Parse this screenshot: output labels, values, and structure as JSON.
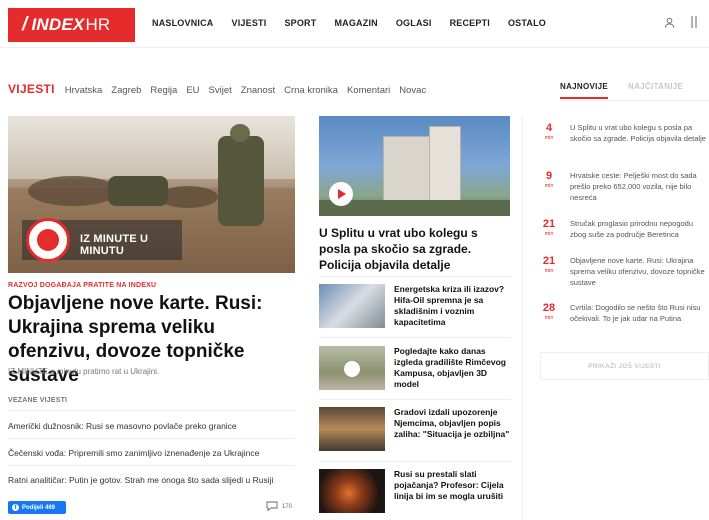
{
  "header": {
    "logo_text": "INDEX",
    "logo_suffix": "HR",
    "nav": [
      "NASLOVNICA",
      "VIJESTI",
      "SPORT",
      "MAGAZIN",
      "OGLASI",
      "RECEPTI",
      "OSTALO"
    ],
    "icons": [
      "user-icon",
      "menu-icon"
    ]
  },
  "section": {
    "title": "VIJESTI",
    "subnav": [
      "Hrvatska",
      "Zagreb",
      "Regija",
      "EU",
      "Svijet",
      "Znanost",
      "Crna kronika",
      "Komentari",
      "Novac"
    ]
  },
  "tabs": {
    "latest": "NAJNOVIJE",
    "most_read": "NAJČITANIJE"
  },
  "hero": {
    "live_badge": "IZ MINUTE U MINUTU",
    "kicker": "RAZVOJ DOGAĐAJA PRATITE NA INDEXU",
    "title": "Objavljene nove karte. Rusi: Ukrajina sprema veliku ofenzivu, dovoze topničke sustave",
    "lead": "IZ MINUTE u minutu pratimo rat u Ukrajini.",
    "related_heading": "VEZANE VIJESTI",
    "related": [
      "Američki dužnosnik: Rusi se masovno povlače preko granice",
      "Čečenski vođa: Pripremili smo zanimljivo iznenađenje za Ukrajince",
      "Ratni analitičar: Putin je gotov. Strah me onoga što sada slijedi u Rusiji"
    ],
    "fb_label": "Podijeli 469",
    "comments": "170"
  },
  "featured": {
    "title": "U Splitu u vrat ubo kolegu s posla pa skočio sa zgrade. Policija objavila detalje"
  },
  "items": [
    {
      "title": "Energetska kriza ili izazov? Hifa-Oil spremna je sa skladišnim i voznim kapacitetima"
    },
    {
      "title": "Pogledajte kako danas izgleda gradilište Rimčevog Kampusa, objavljen 3D model"
    },
    {
      "title": "Gradovi izdali upozorenje Njemcima, objavljen popis zaliha: \"Situacija je ozbiljna\""
    },
    {
      "title": "Rusi su prestali slati pojačanja? Profesor: Cijela linija bi im se mogla urušiti"
    }
  ],
  "latest": [
    {
      "num": "4",
      "unit": "min",
      "text": "U Splitu u vrat ubo kolegu s posla pa skočio sa zgrade. Policija objavila detalje"
    },
    {
      "num": "9",
      "unit": "min",
      "text": "Hrvatske ceste: Pelješki most do sada prešlo preko 652.000 vozila, nije bilo nesreća"
    },
    {
      "num": "21",
      "unit": "min",
      "text": "Stručak proglasio prirodnu nepogodu zbog suše za područje Beretinca"
    },
    {
      "num": "21",
      "unit": "min",
      "text": "Objavljene nove karte. Rusi: Ukrajina sprema veliku ofenzivu, dovoze topničke sustave"
    },
    {
      "num": "28",
      "unit": "min",
      "text": "Cvrtila: Dogodilo se nešto što Rusi nisu očekivali. To je jak udar na Putina"
    }
  ],
  "more_label": "PRIKAŽI JOŠ VIJESTI",
  "colors": {
    "brand_red": "#e52b2b",
    "facebook": "#1877f2"
  }
}
